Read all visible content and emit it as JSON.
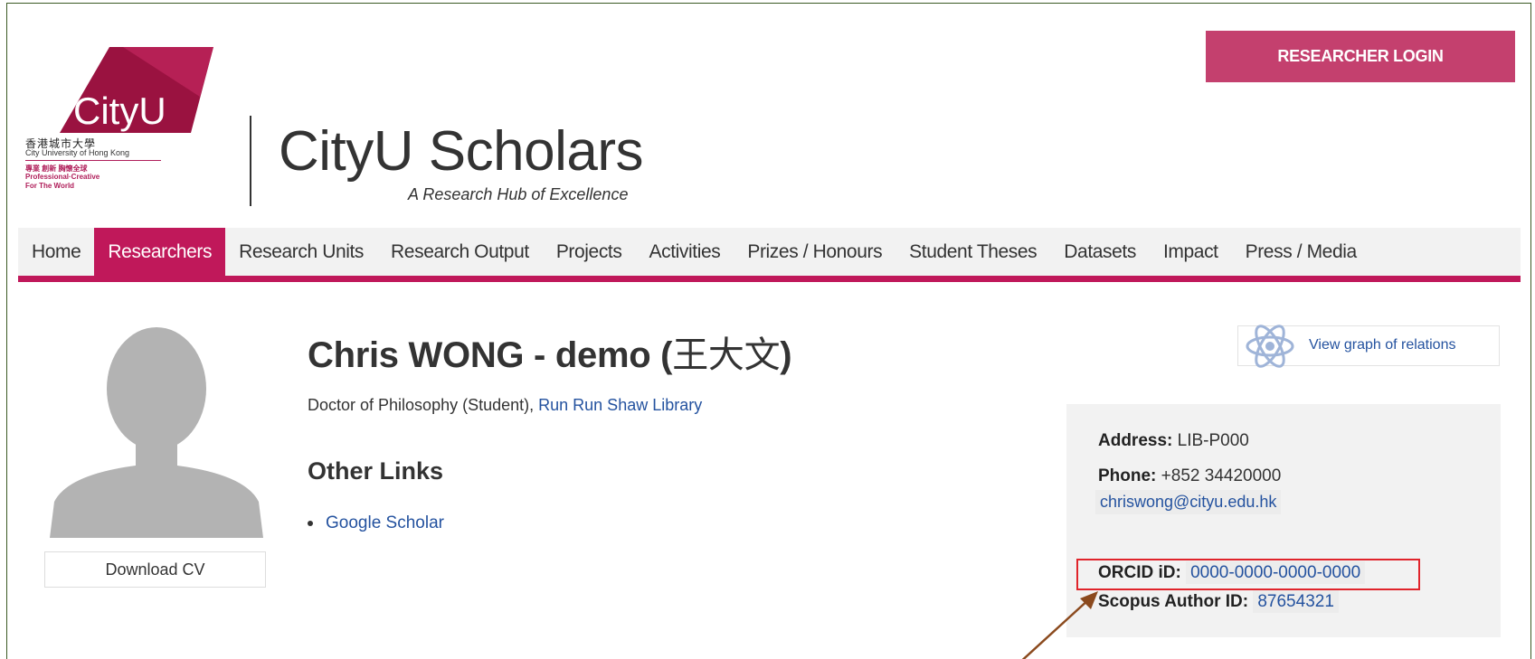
{
  "header": {
    "logo_wordmark": "CityU",
    "logo_cn": "香港城市大學",
    "logo_en": "City University of Hong Kong",
    "logo_tag_cn": "專業 創新 胸懷全球",
    "logo_tag_en1": "Professional·Creative",
    "logo_tag_en2": "For The World",
    "site_title": "CityU Scholars",
    "site_subtitle": "A Research Hub of Excellence",
    "login_label": "RESEARCHER LOGIN"
  },
  "nav": {
    "items": [
      {
        "label": "Home"
      },
      {
        "label": "Researchers"
      },
      {
        "label": "Research Units"
      },
      {
        "label": "Research Output"
      },
      {
        "label": "Projects"
      },
      {
        "label": "Activities"
      },
      {
        "label": "Prizes / Honours"
      },
      {
        "label": "Student Theses"
      },
      {
        "label": "Datasets"
      },
      {
        "label": "Impact"
      },
      {
        "label": "Press / Media"
      }
    ],
    "active": "Researchers"
  },
  "profile": {
    "name": "Chris WONG - demo (",
    "name_cn": "王大文",
    "name_close": ")",
    "position_prefix": "Doctor of Philosophy (Student), ",
    "department": "Run Run Shaw Library",
    "other_links_heading": "Other Links",
    "links": [
      "Google Scholar"
    ],
    "download_cv_label": "Download CV",
    "graph_label": "View graph of relations"
  },
  "contact": {
    "address_label": "Address:",
    "address": "LIB-P000",
    "phone_label": "Phone:",
    "phone": "+852 34420000",
    "email": "chriswong@cityu.edu.hk",
    "orcid_label": "ORCID iD:",
    "orcid": "0000-0000-0000-0000",
    "scopus_label": "Scopus Author ID:",
    "scopus": "87654321"
  },
  "colors": {
    "brand": "#c0185a",
    "login_bg": "#c4406e",
    "link": "#24529f",
    "highlight_box": "#e0242b",
    "arrow": "#8b4a1e"
  }
}
